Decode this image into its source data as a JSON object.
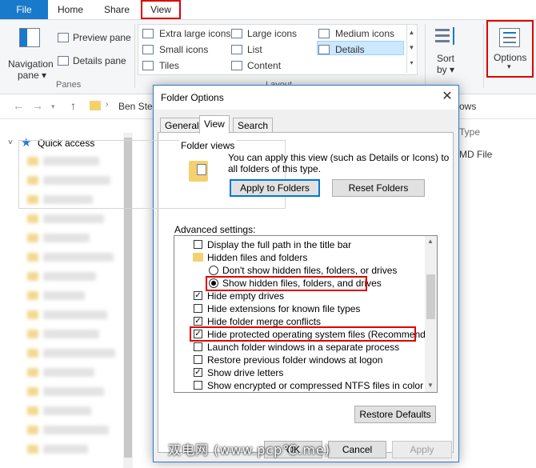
{
  "ribbon_tabs": {
    "file": "File",
    "home": "Home",
    "share": "Share",
    "view": "View"
  },
  "ribbon": {
    "navigation_pane": "Navigation",
    "navigation_pane2": "pane ▾",
    "preview_pane": "Preview pane",
    "details_pane": "Details pane",
    "panes_group": "Panes",
    "layout_items": [
      "Extra large icons",
      "Large icons",
      "Medium icons",
      "Small icons",
      "List",
      "Details",
      "Tiles",
      "Content"
    ],
    "layout_group": "Layout",
    "sort_by": "Sort",
    "sort_by2": "by ▾",
    "options": "Options",
    "options_arrow": "▾"
  },
  "address": {
    "path": "Ben Steg",
    "right_text": "ows"
  },
  "sidebar": {
    "quick_access": "Quick access"
  },
  "background_columns": {
    "type_header": "Type",
    "type_value": "MD File"
  },
  "dialog": {
    "title": "Folder Options",
    "close": "✕",
    "tabs": [
      "General",
      "View",
      "Search"
    ],
    "folder_views_label": "Folder views",
    "folder_views_desc_1": "You can apply this view (such as Details or Icons) to",
    "folder_views_desc_2": "all folders of this type.",
    "apply_to_folders": "Apply to Folders",
    "reset_folders": "Reset Folders",
    "advanced_label": "Advanced settings:",
    "advanced_items": [
      "Display the full path in the title bar",
      "Hidden files and folders",
      "Don't show hidden files, folders, or drives",
      "Show hidden files, folders, and drives",
      "Hide empty drives",
      "Hide extensions for known file types",
      "Hide folder merge conflicts",
      "Hide protected operating system files (Recommended)",
      "Launch folder windows in a separate process",
      "Restore previous folder windows at logon",
      "Show drive letters",
      "Show encrypted or compressed NTFS files in color"
    ],
    "restore_defaults": "Restore Defaults",
    "ok": "OK",
    "cancel": "Cancel",
    "apply": "Apply"
  },
  "watermark": "双电网 (www.pcp℃.me)",
  "colors": {
    "file_tab": "#1979ca",
    "highlight": "#dd0000",
    "dialog_border": "#2b79d7",
    "selection": "#cce8ff"
  }
}
